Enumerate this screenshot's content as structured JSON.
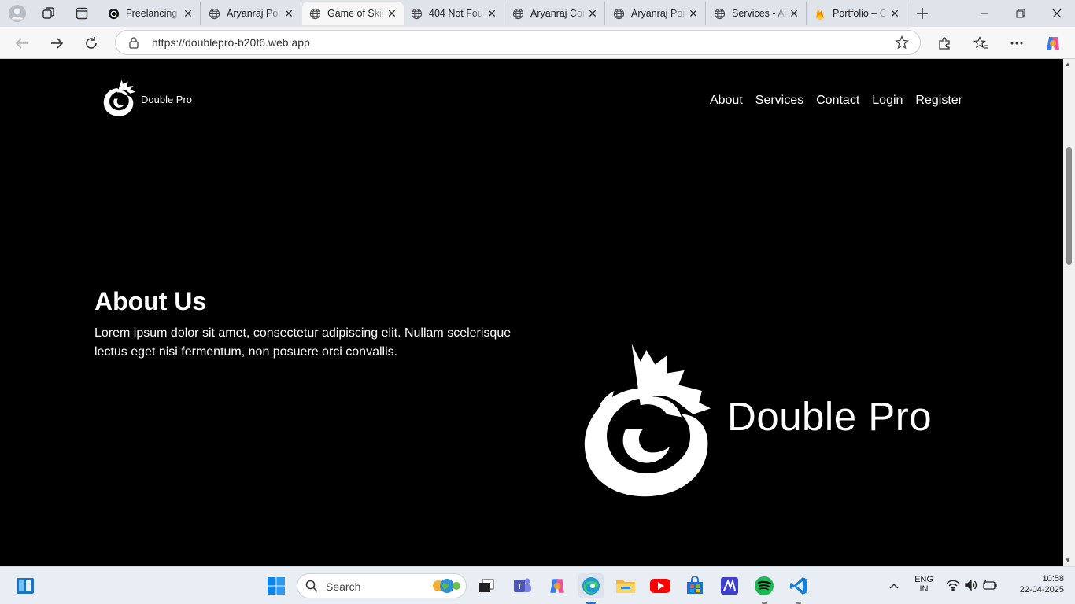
{
  "browser": {
    "tabs": [
      {
        "title": "Freelancing P",
        "icon": "openai-icon",
        "active": false
      },
      {
        "title": "Aryanraj Port",
        "icon": "globe-icon",
        "active": false
      },
      {
        "title": "Game of Skill",
        "icon": "globe-icon",
        "active": true
      },
      {
        "title": "404 Not Fou",
        "icon": "globe-icon",
        "active": false
      },
      {
        "title": "Aryanraj Con",
        "icon": "globe-icon",
        "active": false
      },
      {
        "title": "Aryanraj Port",
        "icon": "globe-icon",
        "active": false
      },
      {
        "title": "Services - Ar",
        "icon": "globe-icon",
        "active": false
      },
      {
        "title": "Portfolio – Cl",
        "icon": "firebase-icon",
        "active": false
      }
    ],
    "url": "https://doublepro-b20f6.web.app"
  },
  "site": {
    "brand": "Double Pro",
    "nav": [
      "About",
      "Services",
      "Contact",
      "Login",
      "Register"
    ],
    "about": {
      "title": "About Us",
      "text": "Lorem ipsum dolor sit amet, consectetur adipiscing elit. Nullam scelerisque lectus eget nisi fermentum, non posuere orci convallis."
    },
    "hero_brand": "Double Pro"
  },
  "taskbar": {
    "search_label": "Search",
    "lang": "ENG",
    "region": "IN",
    "time": "10:58",
    "date": "22-04-2025"
  },
  "colors": {
    "page_bg": "#000000",
    "page_text": "#ffffff",
    "tabstrip_bg": "#dfe3ea",
    "taskbar_bg": "#e9eef5"
  }
}
